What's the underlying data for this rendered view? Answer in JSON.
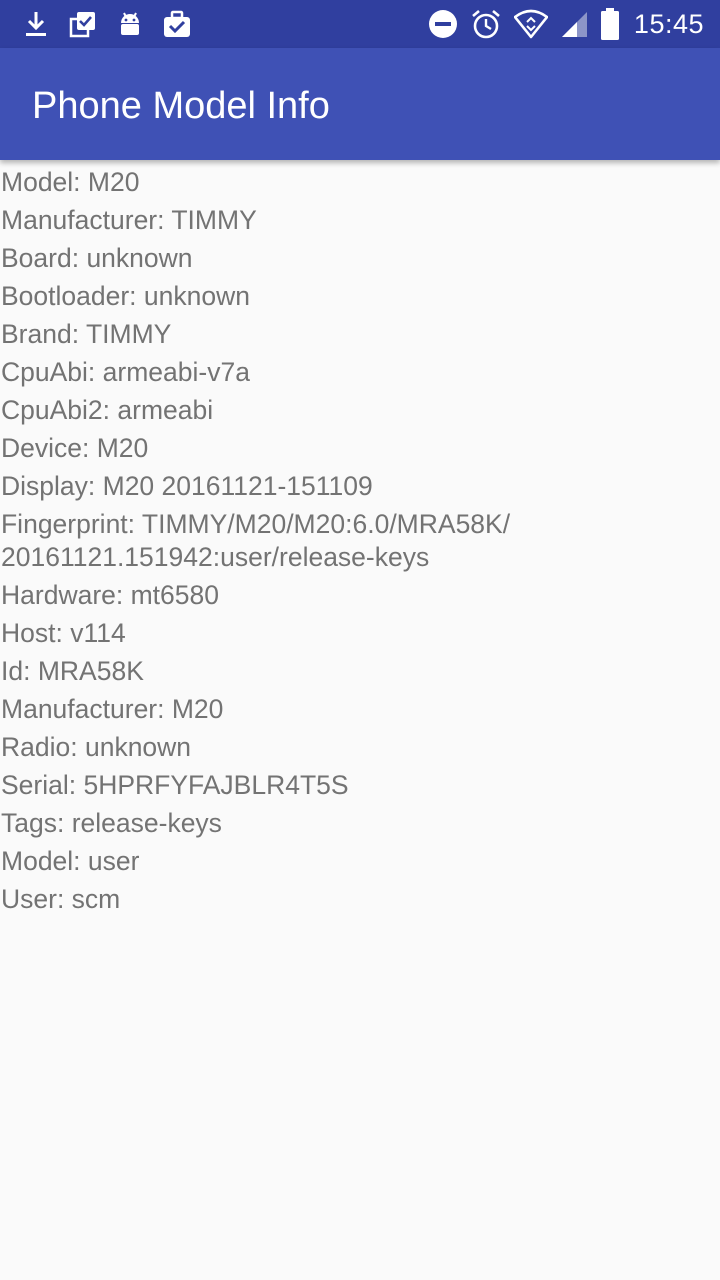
{
  "status_bar": {
    "time": "15:45",
    "left_icons": [
      "download-icon",
      "clipboard-check-icon",
      "android-icon",
      "briefcase-check-icon"
    ],
    "right_icons": [
      "do-not-disturb-icon",
      "alarm-icon",
      "wifi-icon",
      "cell-signal-icon",
      "battery-icon"
    ]
  },
  "app_bar": {
    "title": "Phone Model Info"
  },
  "info_lines": [
    "Model: M20",
    "Manufacturer: TIMMY",
    "Board: unknown",
    "Bootloader: unknown",
    "Brand: TIMMY",
    "CpuAbi: armeabi-v7a",
    "CpuAbi2: armeabi",
    "Device: M20",
    "Display: M20 20161121-151109",
    "Fingerprint: TIMMY/M20/M20:6.0/MRA58K/ 20161121.151942:user/release-keys",
    "Hardware: mt6580",
    "Host: v114",
    "Id: MRA58K",
    "Manufacturer: M20",
    "Radio: unknown",
    "Serial: 5HPRFYFAJBLR4T5S",
    "Tags: release-keys",
    "Model: user",
    "User: scm"
  ],
  "colors": {
    "status_bar": "#303f9f",
    "app_bar": "#3f51b5",
    "background": "#fafafa",
    "text": "#737373"
  }
}
